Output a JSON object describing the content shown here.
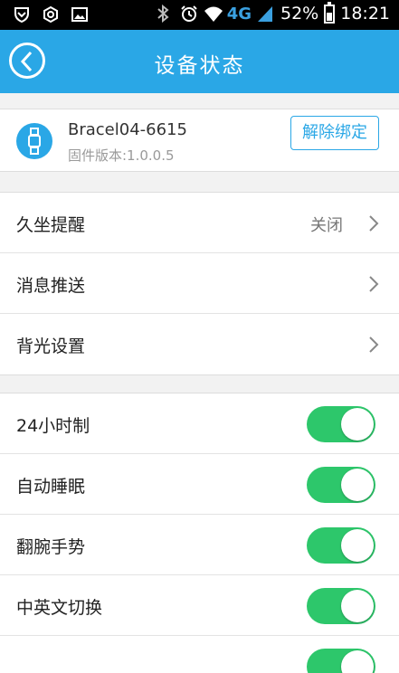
{
  "status_bar": {
    "signal_type": "4G",
    "battery_text": "52%",
    "battery_level": 0.52,
    "time": "18:21",
    "left_icons": [
      "shield-icon",
      "hexagon-icon",
      "image-icon"
    ],
    "right_icons": [
      "bluetooth-icon",
      "alarm-icon",
      "wifi-icon",
      "cell-signal-icon",
      "battery-icon"
    ]
  },
  "header": {
    "title": "设备状态",
    "back_icon": "back-arrow-icon",
    "color": "#2aa7e6"
  },
  "device": {
    "name": "Bracel04-6615",
    "firmware": "固件版本:1.0.0.5",
    "icon": "watch-icon",
    "unbind_label": "解除绑定"
  },
  "settings_nav": [
    {
      "label": "久坐提醒",
      "value": "关闭"
    },
    {
      "label": "消息推送",
      "value": ""
    },
    {
      "label": "背光设置",
      "value": ""
    }
  ],
  "settings_toggles": [
    {
      "label": "24小时制",
      "on": true
    },
    {
      "label": "自动睡眠",
      "on": true
    },
    {
      "label": "翻腕手势",
      "on": true
    },
    {
      "label": "中英文切换",
      "on": true
    },
    {
      "label": "",
      "on": true
    }
  ],
  "colors": {
    "toggle_on": "#2dc76b",
    "accent": "#2aa7e6"
  }
}
